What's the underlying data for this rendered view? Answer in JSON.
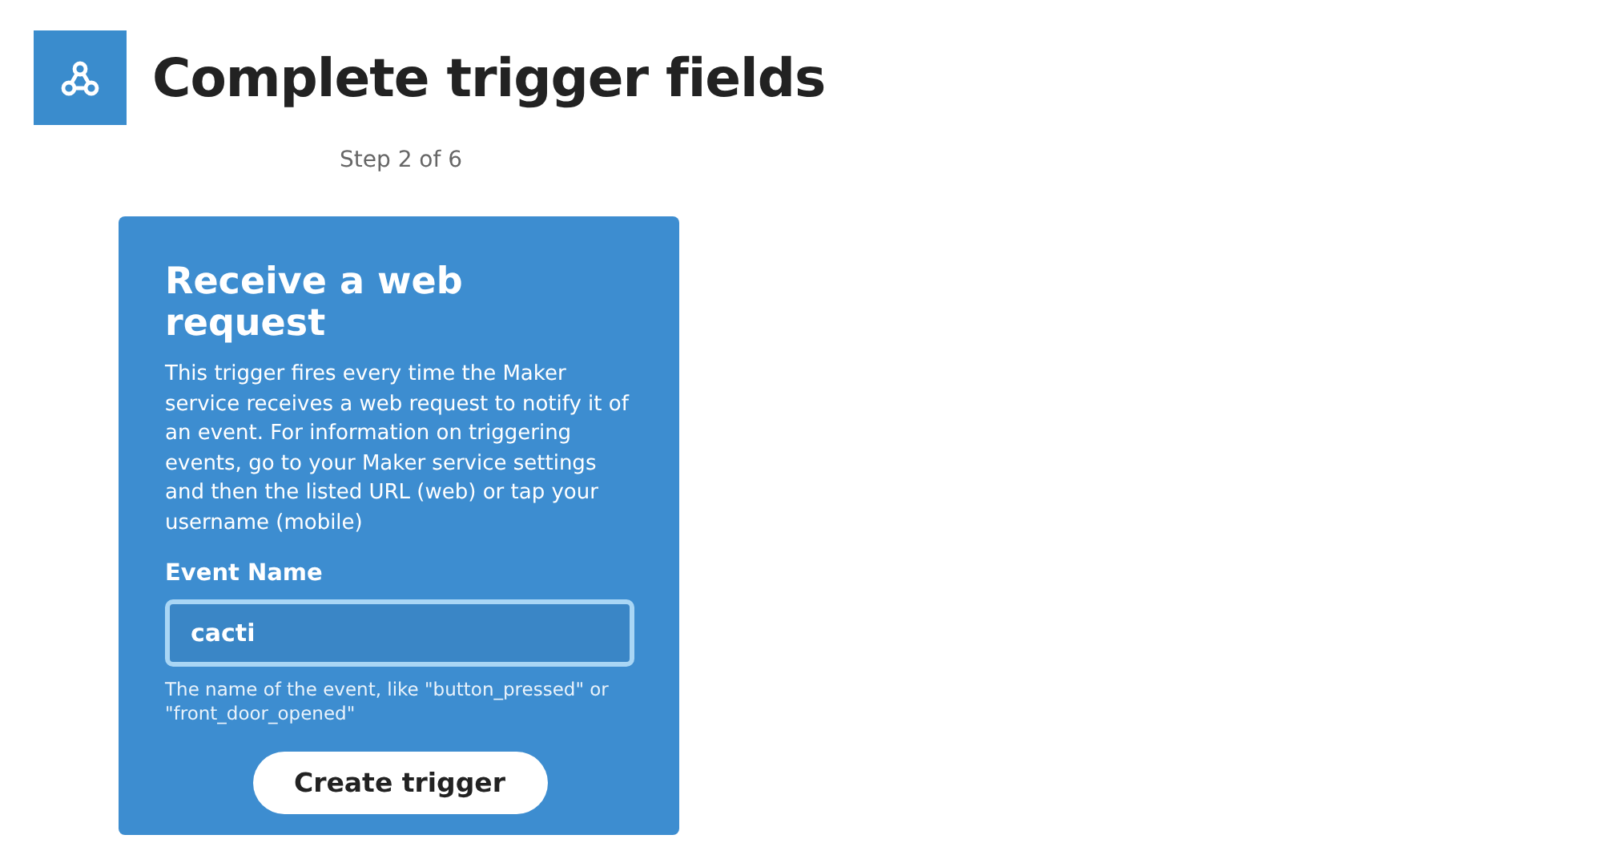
{
  "header": {
    "title": "Complete trigger fields",
    "step": "Step 2 of 6"
  },
  "card": {
    "title": "Receive a web request",
    "description": "This trigger fires every time the Maker service receives a web request to notify it of an event. For information on triggering events, go to your Maker service settings and then the listed URL (web) or tap your username (mobile)",
    "field": {
      "label": "Event Name",
      "value": "cacti",
      "focused": true,
      "help": "The name of the event, like \"button_pressed\" or \"front_door_opened\""
    },
    "button": "Create trigger"
  }
}
